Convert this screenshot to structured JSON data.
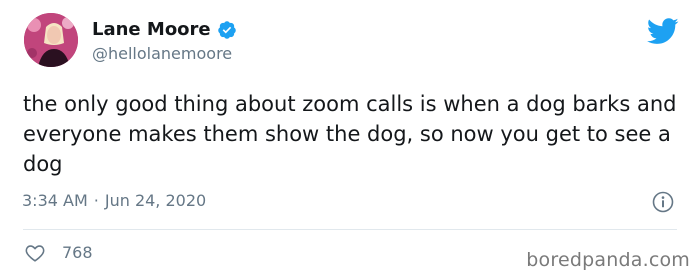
{
  "author": {
    "name": "Lane Moore",
    "handle": "@hellolanemoore",
    "verified": true,
    "avatar_icon": "profile-photo"
  },
  "tweet": {
    "text": "the only good thing about zoom calls is when a dog barks and everyone makes them show the dog, so now you get to see a dog",
    "time": "3:34 AM",
    "separator": "·",
    "date": "Jun 24, 2020"
  },
  "engagement": {
    "likes": "768"
  },
  "icons": {
    "logo": "twitter-bird-icon",
    "verified": "verified-badge-icon",
    "info": "info-icon",
    "like": "heart-icon"
  },
  "colors": {
    "brand_blue": "#1da1f2",
    "text_primary": "#14171a",
    "text_secondary": "#657786",
    "divider": "#e1e8ed"
  },
  "watermark": {
    "text": "boredpanda.com"
  }
}
